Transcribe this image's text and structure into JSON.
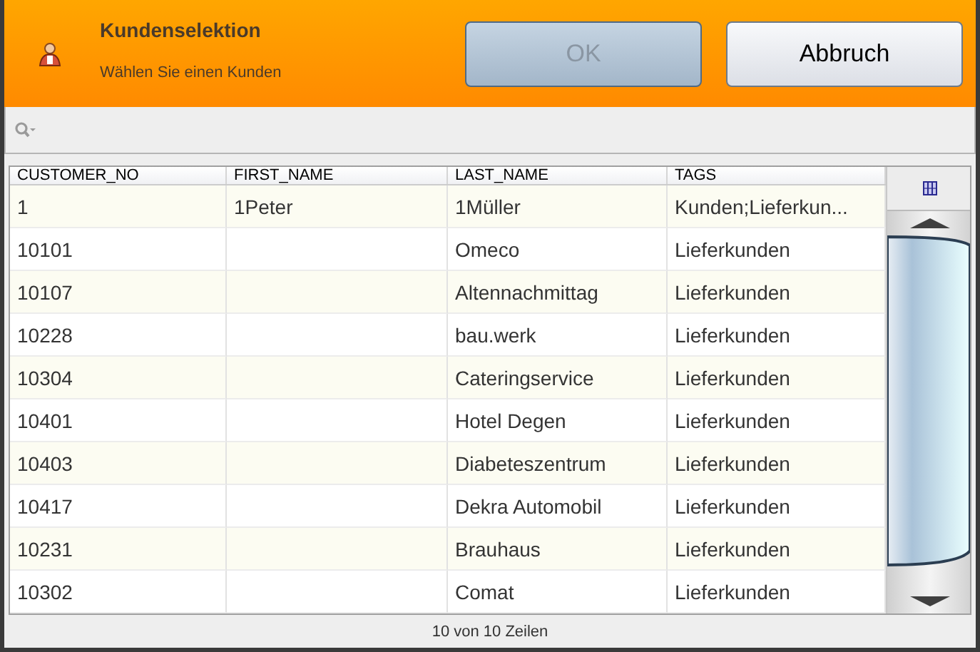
{
  "header": {
    "title": "Kundenselektion",
    "subtitle": "Wählen Sie einen Kunden"
  },
  "buttons": [
    {
      "label": "OK",
      "disabled": true
    },
    {
      "label": "Abbruch",
      "disabled": false
    }
  ],
  "table": {
    "columns": [
      "CUSTOMER_NO",
      "FIRST_NAME",
      "LAST_NAME",
      "TAGS"
    ],
    "rows": [
      [
        "1",
        "1Peter",
        "1Müller",
        "Kunden;Lieferkun..."
      ],
      [
        "10101",
        "",
        "Omeco",
        "Lieferkunden"
      ],
      [
        "10107",
        "",
        "Altennachmittag",
        "Lieferkunden"
      ],
      [
        "10228",
        "",
        "bau.werk",
        "Lieferkunden"
      ],
      [
        "10304",
        "",
        "Cateringservice",
        "Lieferkunden"
      ],
      [
        "10401",
        "",
        "Hotel Degen",
        "Lieferkunden"
      ],
      [
        "10403",
        "",
        "Diabeteszentrum",
        "Lieferkunden"
      ],
      [
        "10417",
        "",
        "Dekra Automobil",
        "Lieferkunden"
      ],
      [
        "10231",
        "",
        "Brauhaus",
        "Lieferkunden"
      ],
      [
        "10302",
        "",
        "Comat",
        "Lieferkunden"
      ]
    ]
  },
  "status_bar": "10 von 10 Zeilen"
}
